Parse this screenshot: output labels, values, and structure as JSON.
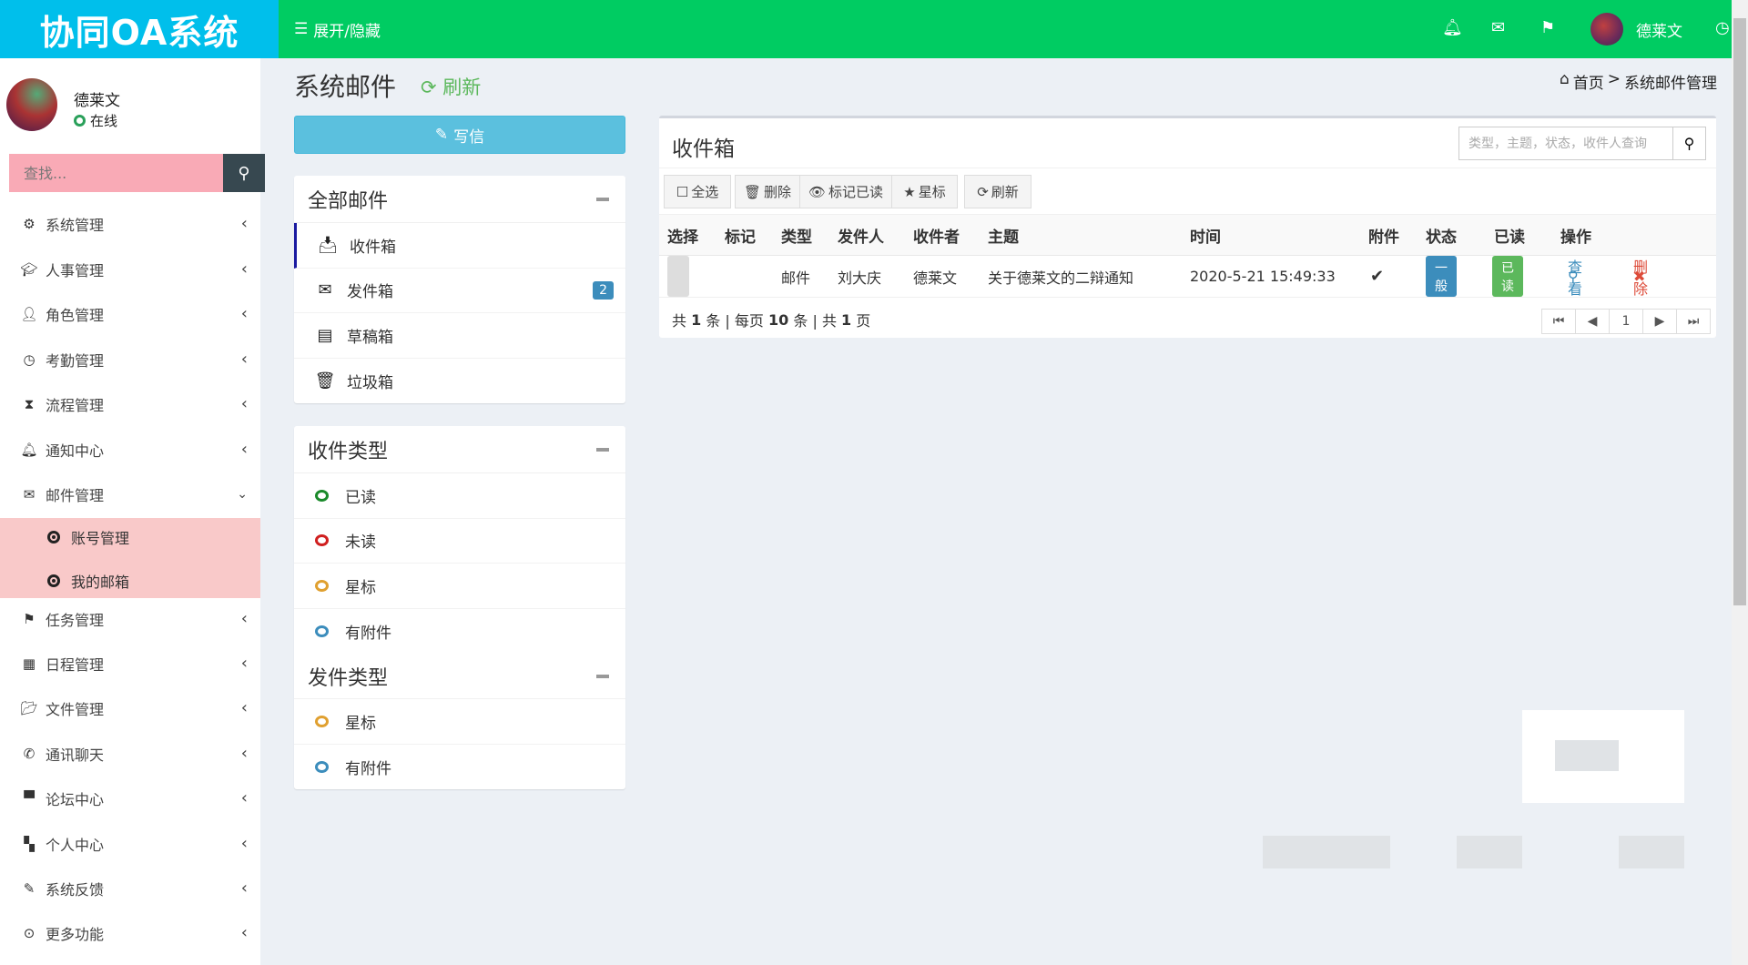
{
  "header": {
    "logo": "协同OA系统",
    "toggle_label": "展开/隐藏",
    "user_name": "德莱文"
  },
  "sidebar": {
    "user_name": "德莱文",
    "status": "在线",
    "search_placeholder": "查找...",
    "items": [
      {
        "label": "系统管理",
        "icon": "gear-icon"
      },
      {
        "label": "人事管理",
        "icon": "graduation-cap-icon"
      },
      {
        "label": "角色管理",
        "icon": "user-icon"
      },
      {
        "label": "考勤管理",
        "icon": "clock-icon"
      },
      {
        "label": "流程管理",
        "icon": "hourglass-icon"
      },
      {
        "label": "通知中心",
        "icon": "bell-icon"
      },
      {
        "label": "邮件管理",
        "icon": "envelope-icon"
      }
    ],
    "sub_items": [
      {
        "label": "账号管理"
      },
      {
        "label": "我的邮箱"
      }
    ],
    "items2": [
      {
        "label": "任务管理",
        "icon": "flag-icon"
      },
      {
        "label": "日程管理",
        "icon": "calendar-icon"
      },
      {
        "label": "文件管理",
        "icon": "folder-open-icon"
      },
      {
        "label": "通讯聊天",
        "icon": "phone-icon"
      },
      {
        "label": "论坛中心",
        "icon": "comment-icon"
      },
      {
        "label": "个人中心",
        "icon": "grid-icon"
      },
      {
        "label": "系统反馈",
        "icon": "pencil-icon"
      },
      {
        "label": "更多功能",
        "icon": "circle-dot-icon"
      }
    ]
  },
  "page": {
    "title": "系统邮件",
    "refresh": "刷新",
    "breadcrumb_home": "首页",
    "breadcrumb_sep": ">",
    "breadcrumb_current": "系统邮件管理"
  },
  "compose_label": "写信",
  "folders": {
    "title": "全部邮件",
    "items": [
      {
        "label": "收件箱"
      },
      {
        "label": "发件箱",
        "badge": "2"
      },
      {
        "label": "草稿箱"
      },
      {
        "label": "垃圾箱"
      }
    ]
  },
  "inbox_types": {
    "title": "收件类型",
    "items": [
      {
        "label": "已读",
        "color": "#1a8a2a"
      },
      {
        "label": "未读",
        "color": "#d02020"
      },
      {
        "label": "星标",
        "color": "#e0a030"
      },
      {
        "label": "有附件",
        "color": "#3c8dbc"
      }
    ]
  },
  "send_types": {
    "title": "发件类型",
    "items": [
      {
        "label": "星标",
        "color": "#e0a030"
      },
      {
        "label": "有附件",
        "color": "#3c8dbc"
      }
    ]
  },
  "inbox": {
    "title": "收件箱",
    "search_placeholder": "类型，主题，状态，收件人查询",
    "toolbar": {
      "select_all": "全选",
      "delete": "删除",
      "mark_read": "标记已读",
      "star": "星标",
      "refresh": "刷新"
    },
    "columns": [
      "选择",
      "标记",
      "类型",
      "发件人",
      "收件者",
      "主题",
      "时间",
      "附件",
      "状态",
      "已读",
      "操作"
    ],
    "rows": [
      {
        "type": "邮件",
        "sender": "刘大庆",
        "receiver": "德莱文",
        "subject": "关于德莱文的二辩通知",
        "time": "2020-5-21 15:49:33",
        "attachment": "✔",
        "status": "一般",
        "read": "已读",
        "view": "查看",
        "delete": "删除"
      }
    ],
    "footer": {
      "p1": "共",
      "total": "1",
      "p2": "条 | 每页",
      "per_page": "10",
      "p3": "条 | 共",
      "pages": "1",
      "p4": "页"
    },
    "current_page": "1"
  }
}
